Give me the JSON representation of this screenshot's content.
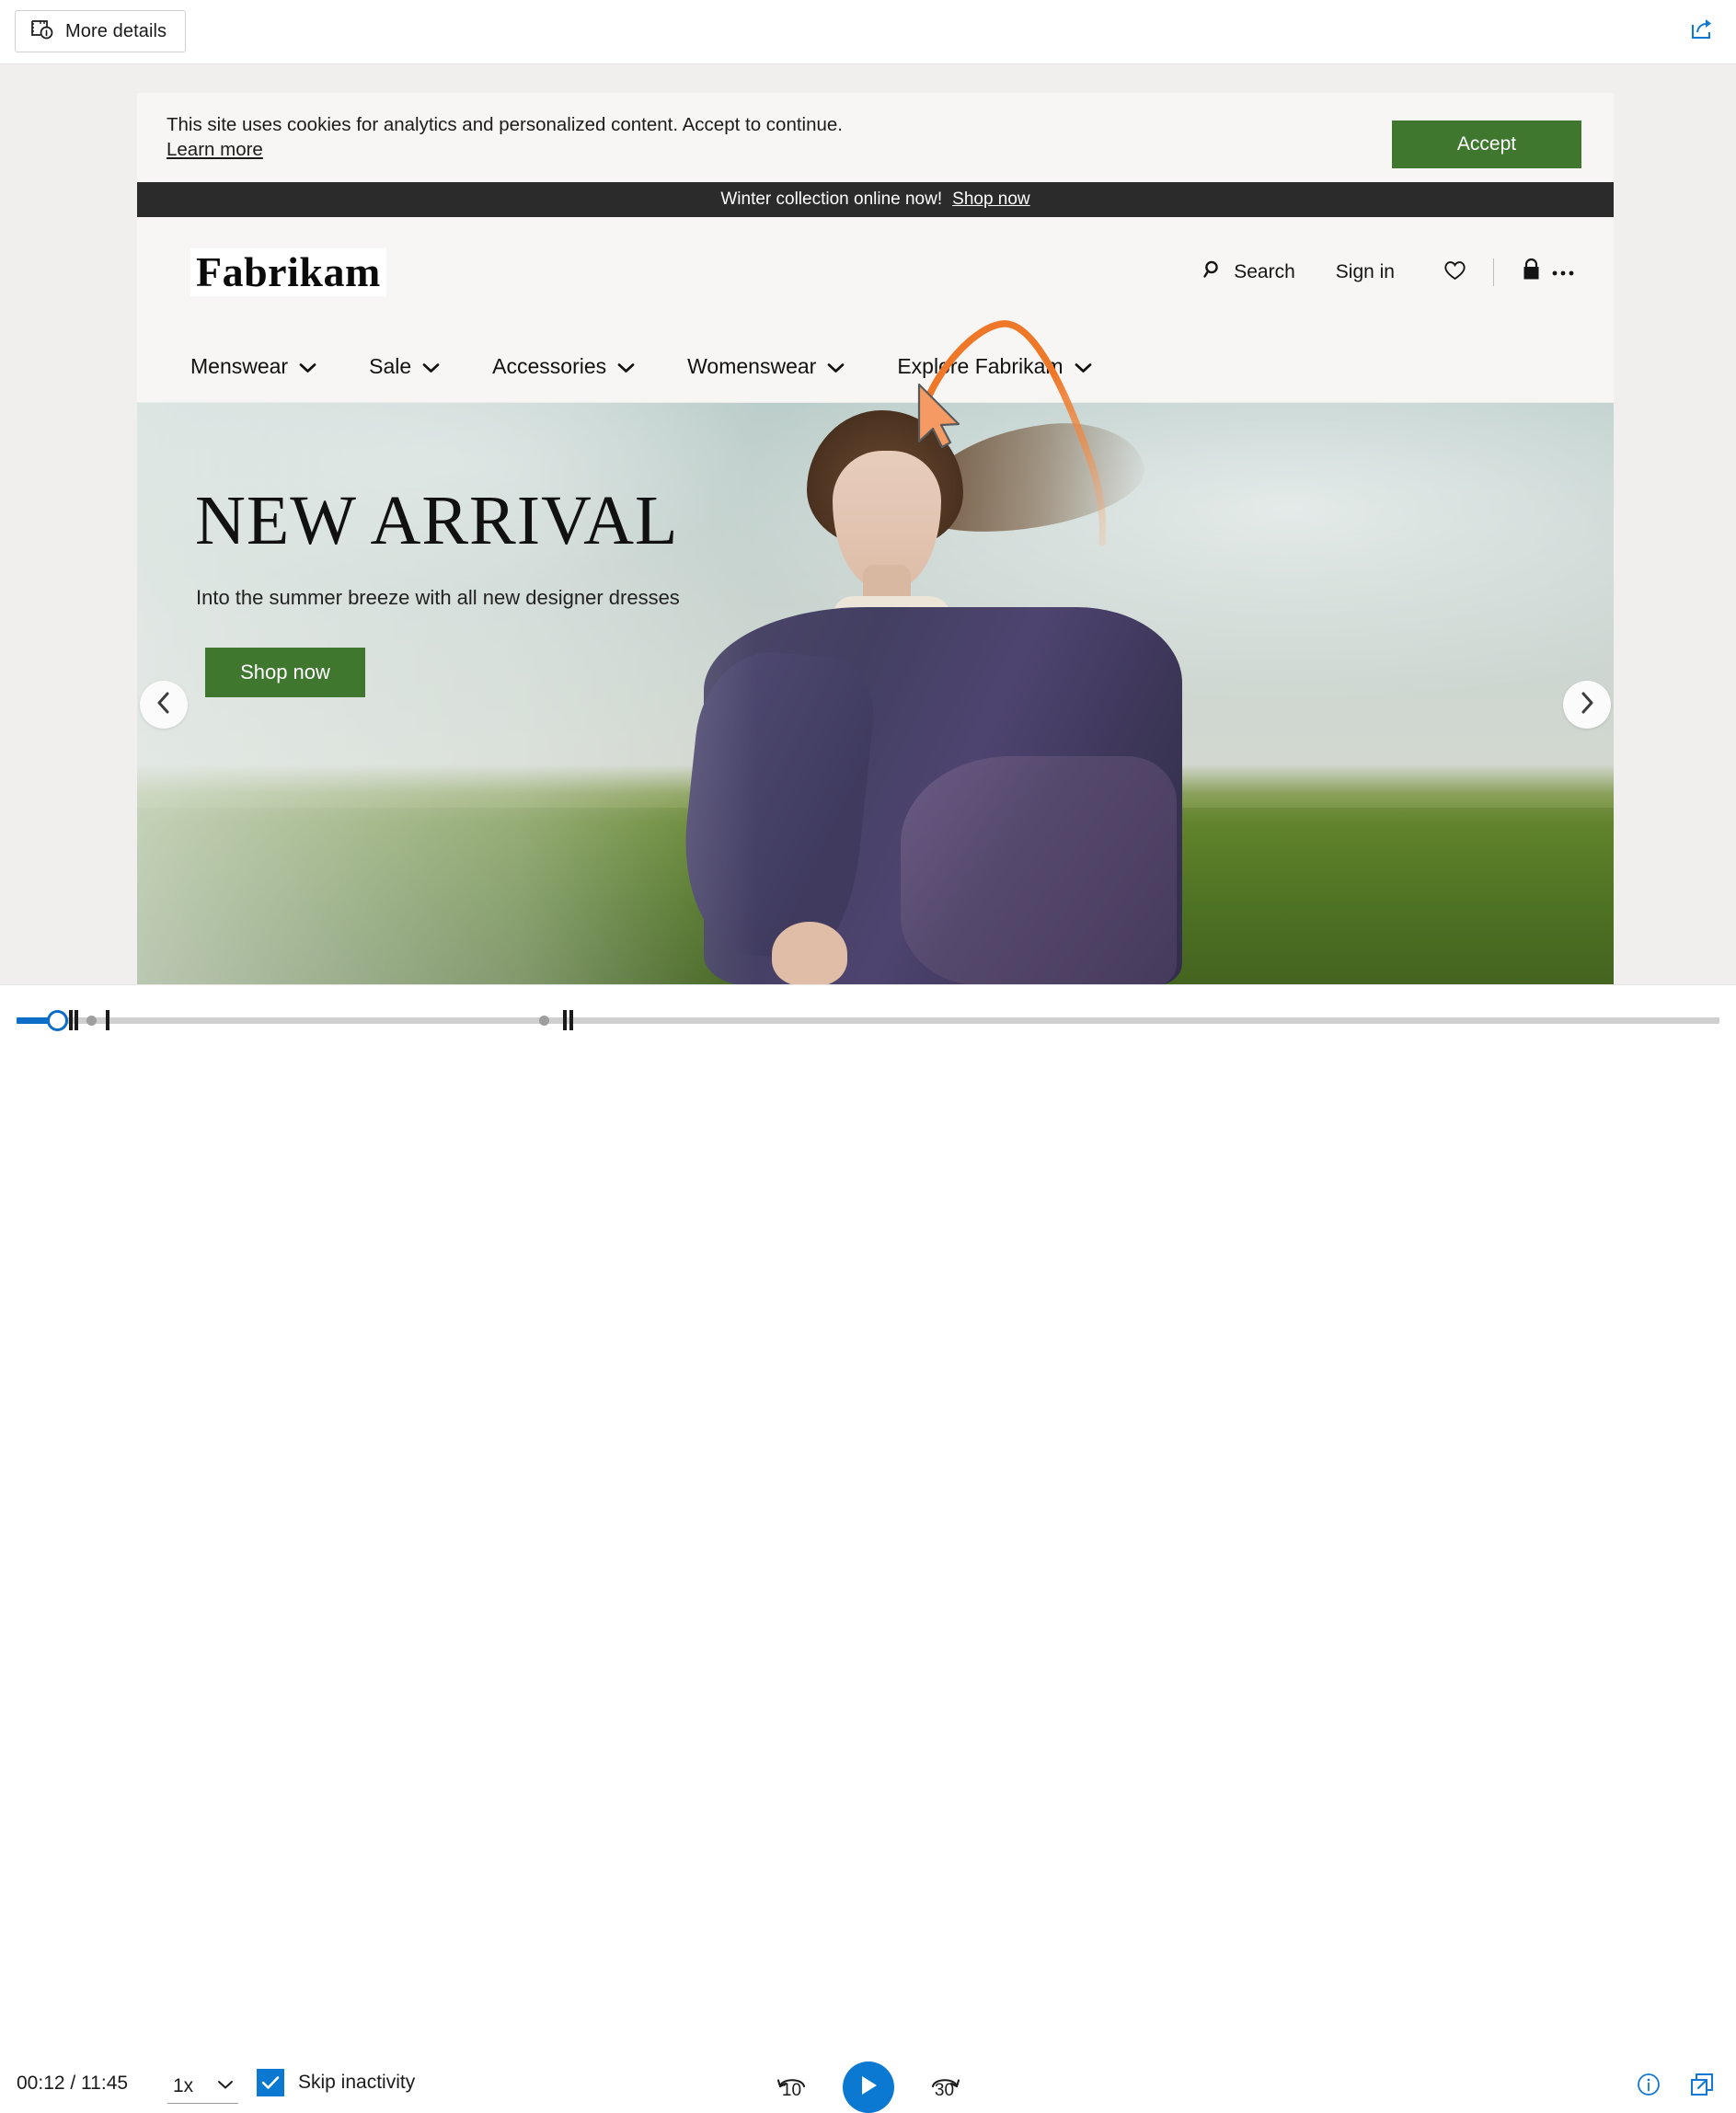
{
  "toolbar": {
    "more_details_label": "More details",
    "more_details_icon": "video-info-icon",
    "share_icon": "share-icon"
  },
  "page": {
    "cookie_banner": {
      "message": "This site uses cookies for analytics and personalized content. Accept to continue.",
      "learn_more_label": "Learn more",
      "accept_label": "Accept",
      "accept_color": "#40772f"
    },
    "promo_bar": {
      "text": "Winter collection online now!",
      "link_label": "Shop now",
      "background": "#2b2b2b"
    },
    "header": {
      "logo_text": "Fabrikam",
      "search_label": "Search",
      "search_icon": "search-icon",
      "signin_label": "Sign in",
      "wishlist_icon": "heart-icon",
      "bag_icon": "shopping-bag-icon",
      "more_icon": "ellipsis-icon"
    },
    "nav": {
      "items": [
        {
          "label": "Menswear",
          "icon": "chevron-down-icon"
        },
        {
          "label": "Sale",
          "icon": "chevron-down-icon"
        },
        {
          "label": "Accessories",
          "icon": "chevron-down-icon"
        },
        {
          "label": "Womenswear",
          "icon": "chevron-down-icon"
        },
        {
          "label": "Explore Fabrikam",
          "icon": "chevron-down-icon"
        }
      ]
    },
    "hero": {
      "title": "NEW ARRIVAL",
      "subtitle": "Into the summer breeze with all new designer dresses",
      "cta_label": "Shop now",
      "cta_color": "#40772f",
      "prev_icon": "chevron-left-icon",
      "next_icon": "chevron-right-icon"
    }
  },
  "annotation": {
    "cursor_trail_color": "#ef7728",
    "cursor_icon": "mouse-pointer-icon"
  },
  "player": {
    "current_time": "00:12",
    "total_time": "11:45",
    "time_display": "00:12 / 11:45",
    "speed_value": "1x",
    "speed_icon": "chevron-down-icon",
    "skip_inactivity_label": "Skip inactivity",
    "skip_inactivity_checked": true,
    "rewind_label": "10",
    "rewind_icon": "rewind-10-icon",
    "forward_label": "30",
    "forward_icon": "forward-30-icon",
    "play_icon": "play-icon",
    "info_icon": "info-icon",
    "popout_icon": "pop-out-icon",
    "accent_color": "#0b78d1",
    "progress_percent": 2
  }
}
